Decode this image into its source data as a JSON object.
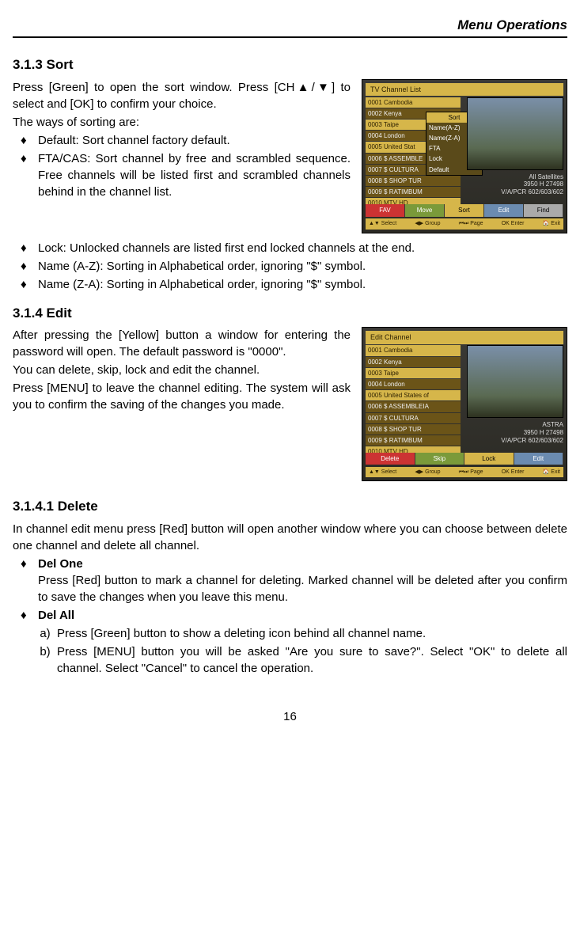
{
  "header": {
    "title": "Menu Operations"
  },
  "s313": {
    "heading": "3.1.3  Sort",
    "p1": "Press [Green] to open the sort window. Press [CH▲/▼] to select and [OK] to confirm your choice.",
    "p2": "The ways of sorting are:",
    "b1": "Default: Sort channel factory default.",
    "b2": "FTA/CAS: Sort channel by free and scrambled sequence. Free channels will be listed first and scrambled channels behind in the channel list.",
    "b3": "Lock: Unlocked channels are listed first end locked channels at the end.",
    "b4": "Name (A-Z): Sorting in Alphabetical order, ignoring \"$\" symbol.",
    "b5": "Name (Z-A): Sorting in Alphabetical order, ignoring \"$\" symbol."
  },
  "img_sort": {
    "title": "TV Channel List",
    "rows": [
      "0001  Cambodia",
      "0002  Kenya",
      "0003  Taipe",
      "0004  London",
      "0005  United Stat",
      "0006 $ ASSEMBLE",
      "0007 $ CULTURA",
      "0008 $ SHOP TUR",
      "0009 $ RATIMBUM",
      "0010  MTV HD"
    ],
    "popup_title": "Sort",
    "popup_items": [
      "Name(A-Z)",
      "Name(Z-A)",
      "FTA",
      "Lock",
      "Default"
    ],
    "info1": "All Satellites",
    "info2": "3950 H 27498",
    "info3": "V/A/PCR 602/603/602",
    "btns": [
      "FAV",
      "Move",
      "Sort",
      "Edit",
      "Find"
    ],
    "hints": [
      "▲▼ Select",
      "◀▶ Group",
      "⏮⏭ Page",
      "OK Enter",
      "🏠 Exit"
    ]
  },
  "s314": {
    "heading": "3.1.4  Edit",
    "p1": "After pressing the [Yellow] button a window for entering the password will open. The default password is \"0000\".",
    "p2": "You can delete, skip, lock and edit the channel.",
    "p3": "Press [MENU] to leave the channel editing. The system will ask you to confirm the saving of the changes you made."
  },
  "img_edit": {
    "title": "Edit Channel",
    "rows": [
      "0001  Cambodia",
      "0002  Kenya",
      "0003  Taipe",
      "0004  London",
      "0005  United States of",
      "0006 $ ASSEMBLEIA",
      "0007 $ CULTURA",
      "0008 $ SHOP TUR",
      "0009 $ RATIMBUM",
      "0010  MTV HD"
    ],
    "info1": "ASTRA",
    "info2": "3950 H 27498",
    "info3": "V/A/PCR 602/603/602",
    "btns": [
      "Delete",
      "Skip",
      "Lock",
      "Edit"
    ],
    "hints": [
      "▲▼ Select",
      "◀▶ Group",
      "⏮⏭ Page",
      "OK Enter",
      "🏠 Exit"
    ]
  },
  "s3141": {
    "heading": "3.1.4.1  Delete",
    "p1": "In channel edit menu press [Red] button will open another window where you can choose between delete one channel and delete all channel.",
    "b1_title": "Del One",
    "b1_text": "Press [Red] button to mark a channel for deleting. Marked channel will be deleted after you confirm to save the changes when you leave this menu.",
    "b2_title": "Del All",
    "b2_a": "Press [Green] button to show a deleting icon behind all channel name.",
    "b2_b": "Press [MENU] button you will be asked \"Are you sure to save?\". Select \"OK\" to delete all channel. Select \"Cancel\" to cancel the operation."
  },
  "page_number": "16"
}
